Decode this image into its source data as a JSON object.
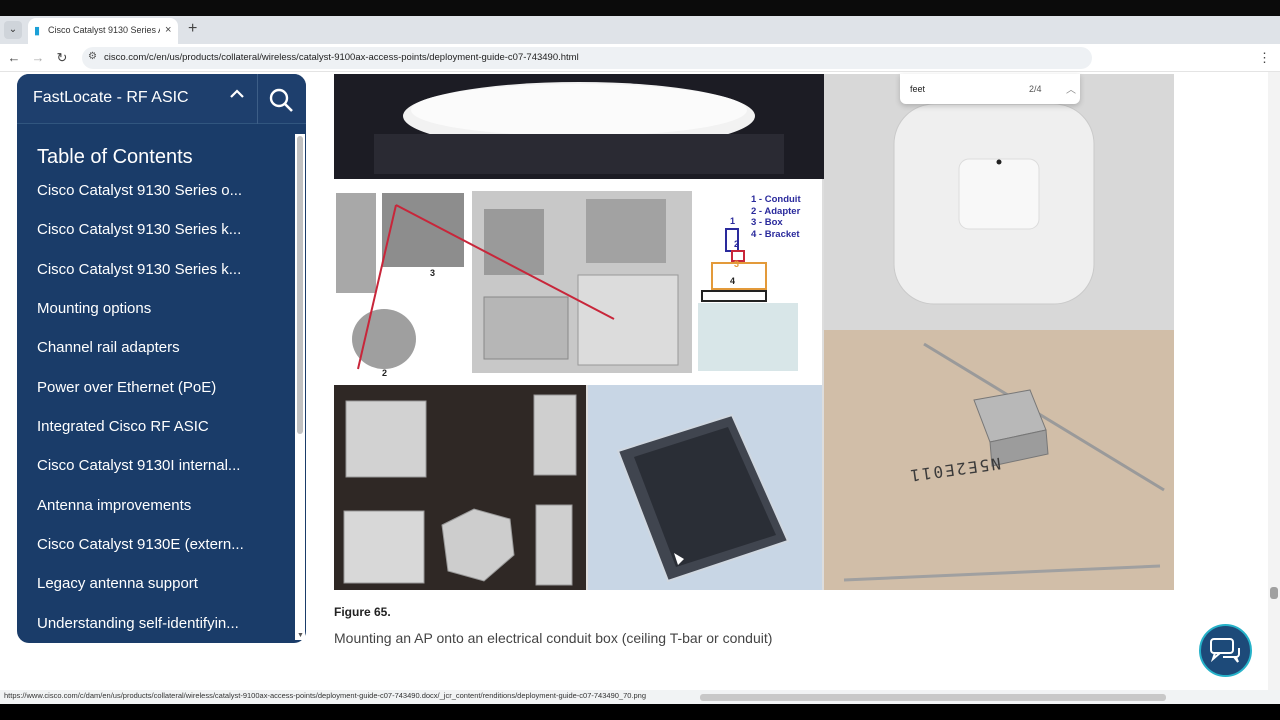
{
  "browser": {
    "tab_title": "Cisco Catalyst 9130 Series Acce",
    "tab_close": "×",
    "new_tab": "+",
    "url": "cisco.com/c/en/us/products/collateral/wireless/catalyst-9100ax-access-points/deployment-guide-c07-743490.html",
    "status_url": "https://www.cisco.com/c/dam/en/us/products/collateral/wireless/catalyst-9100ax-access-points/deployment-guide-c07-743490.docx/_jcr_content/renditions/deployment-guide-c07-743490_70.png"
  },
  "find": {
    "query": "feet",
    "count": "2/4"
  },
  "toc": {
    "header_title": "FastLocate - RF ASIC",
    "title": "Table of Contents",
    "items": [
      "Cisco Catalyst 9130 Series o...",
      "Cisco Catalyst 9130 Series k...",
      "Cisco Catalyst 9130 Series k...",
      "Mounting options",
      "Channel rail adapters",
      "Power over Ethernet (PoE)",
      "Integrated Cisco RF ASIC",
      "Cisco Catalyst 9130I internal...",
      "Antenna improvements",
      "Cisco Catalyst 9130E (extern...",
      "Legacy antenna support",
      "Understanding self-identifyin..."
    ]
  },
  "figure": {
    "label": "Figure 65.",
    "caption": "Mounting an AP onto an electrical conduit box (ceiling T-bar or conduit)",
    "legend": [
      "1 - Conduit",
      "2 - Adapter",
      "3 - Box",
      "4 - Bracket"
    ],
    "markers": [
      "3",
      "2",
      "1",
      "2",
      "3",
      "4"
    ],
    "stamp_text": "N5E2E011"
  },
  "icons": {
    "tab_menu": "chevron-down-icon",
    "back": "arrow-left-icon",
    "forward": "arrow-right-icon",
    "reload": "reload-icon",
    "site_info": "site-info-icon",
    "toc_collapse": "chevron-up-icon",
    "toc_search": "search-icon",
    "chat": "chat-icon"
  },
  "colors": {
    "toc_background": "#1a3c69",
    "chat_ring": "#26b2c9",
    "legend_blue": "#2a2a9c",
    "diagram_red": "#c8263a"
  }
}
